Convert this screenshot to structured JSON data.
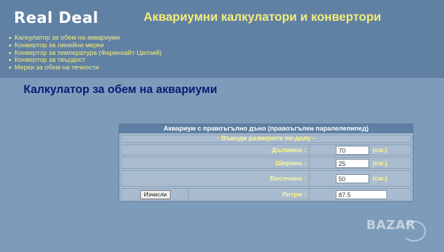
{
  "header": {
    "logo": "Real Deal",
    "site_title": "Аквариумни калкулатори и конвертори"
  },
  "nav": {
    "items": [
      {
        "label": "Калкулатор за обем на аквариуми"
      },
      {
        "label": "Конвертор за линейни мерки"
      },
      {
        "label": "Конвертор за температура (Фаренхайт-Целзий)"
      },
      {
        "label": "Конвертор за твърдост"
      },
      {
        "label": "Мерки за обем на течности"
      }
    ]
  },
  "main": {
    "heading": "Калкулатор за обем на аквариуми",
    "calculator": {
      "title": "Аквариум с правоъгълно дъно (правоъгълен паралелепипед)",
      "subtitle": "- Въведи размерите по-долу -",
      "fields": [
        {
          "label": "Дължина :",
          "value": "70",
          "unit": "(см.)"
        },
        {
          "label": "Ширина :",
          "value": "25",
          "unit": "(см.)"
        },
        {
          "label": "Височина :",
          "value": "50",
          "unit": "(см.)"
        }
      ],
      "calculate_button": "Изчисли",
      "result_label": "Литри :",
      "result_value": "87.5"
    }
  },
  "watermark": {
    "text": "BAZAR"
  },
  "colors": {
    "header_bg": "#6181a4",
    "content_bg": "#7d9cb9",
    "accent_yellow": "#f3ec7a",
    "heading_blue": "#0b1a78"
  }
}
